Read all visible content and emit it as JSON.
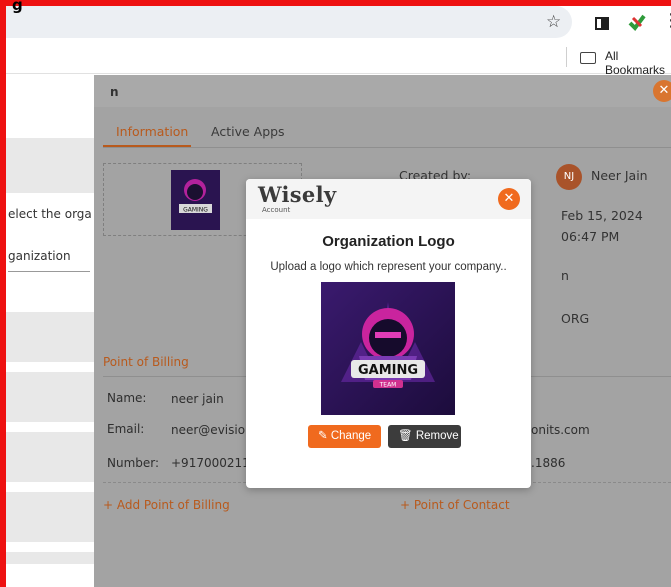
{
  "browser": {
    "tab_fragment": "g",
    "bookmarks_label": "All Bookmarks"
  },
  "background_page": {
    "text_select": "elect the orga",
    "text_org": "ganization"
  },
  "drawer": {
    "title": "n",
    "tabs": [
      {
        "label": "Information",
        "active": true
      },
      {
        "label": "Active Apps",
        "active": false
      }
    ],
    "info": {
      "created_by_label": "Created by:",
      "created_by_initials": "NJ",
      "created_by_name": "Neer Jain",
      "date": "Feb 15, 2024",
      "time": "06:47 PM",
      "field3": "n",
      "field4": "ORG"
    },
    "billing": {
      "title": "Point of Billing",
      "name_label": "Name:",
      "name_value": "neer jain",
      "email_label": "Email:",
      "email_value": "neer@evision",
      "email_value_right": "onits.com",
      "number_label": "Number:",
      "number_value": "+9170002118",
      "number_value_right": ".1886"
    },
    "add_billing": "+ Add Point of Billing",
    "add_contact": "+ Point of Contact"
  },
  "modal": {
    "brand": "Wisely",
    "brand_sub": "Account",
    "title": "Organization Logo",
    "description": "Upload a logo which represent your company..",
    "logo_text_main": "GAMING",
    "logo_text_sub": "TEAM",
    "change_label": "Change",
    "remove_label": "Remove"
  },
  "colors": {
    "accent": "#f06a1e",
    "frame": "#ee1111",
    "overlay": "#a3a3a3"
  }
}
